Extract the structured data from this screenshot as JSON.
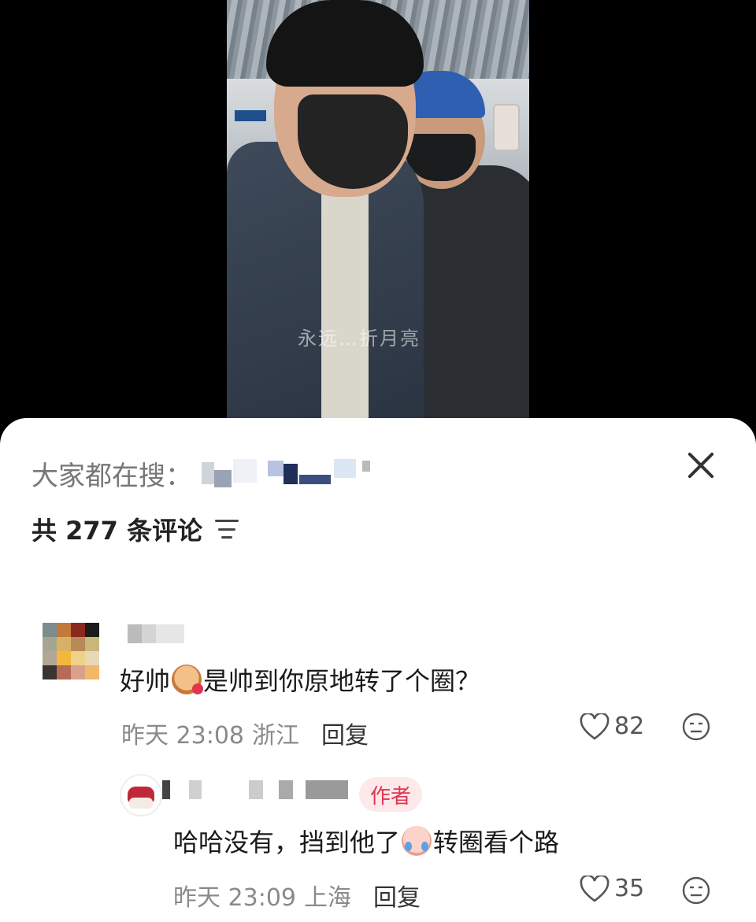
{
  "video": {
    "watermark": "永远…折月亮"
  },
  "sheet": {
    "search_label": "大家都在搜：",
    "close_icon": "close-icon",
    "count_text": "共 277 条评论",
    "sort_icon": "sort-filter-icon"
  },
  "comments": [
    {
      "text_before": "好帅",
      "emoji": "tiger-heart-emoji",
      "text_after": "是帅到你原地转了个圈？",
      "time": "昨天 23:08",
      "location": "浙江",
      "reply_label": "回复",
      "likes": "82"
    }
  ],
  "reply": {
    "badge": "作者",
    "text_before": "哈哈没有，挡到他了",
    "emoji": "crying-laugh-emoji",
    "text_after": "转圈看个路",
    "time": "昨天 23:09",
    "location": "上海",
    "reply_label": "回复",
    "likes": "35"
  },
  "colors": {
    "sheet_bg": "#ffffff",
    "badge_bg": "#fde8ea",
    "badge_text": "#e0344f",
    "meta_text": "#8a8a8a"
  }
}
